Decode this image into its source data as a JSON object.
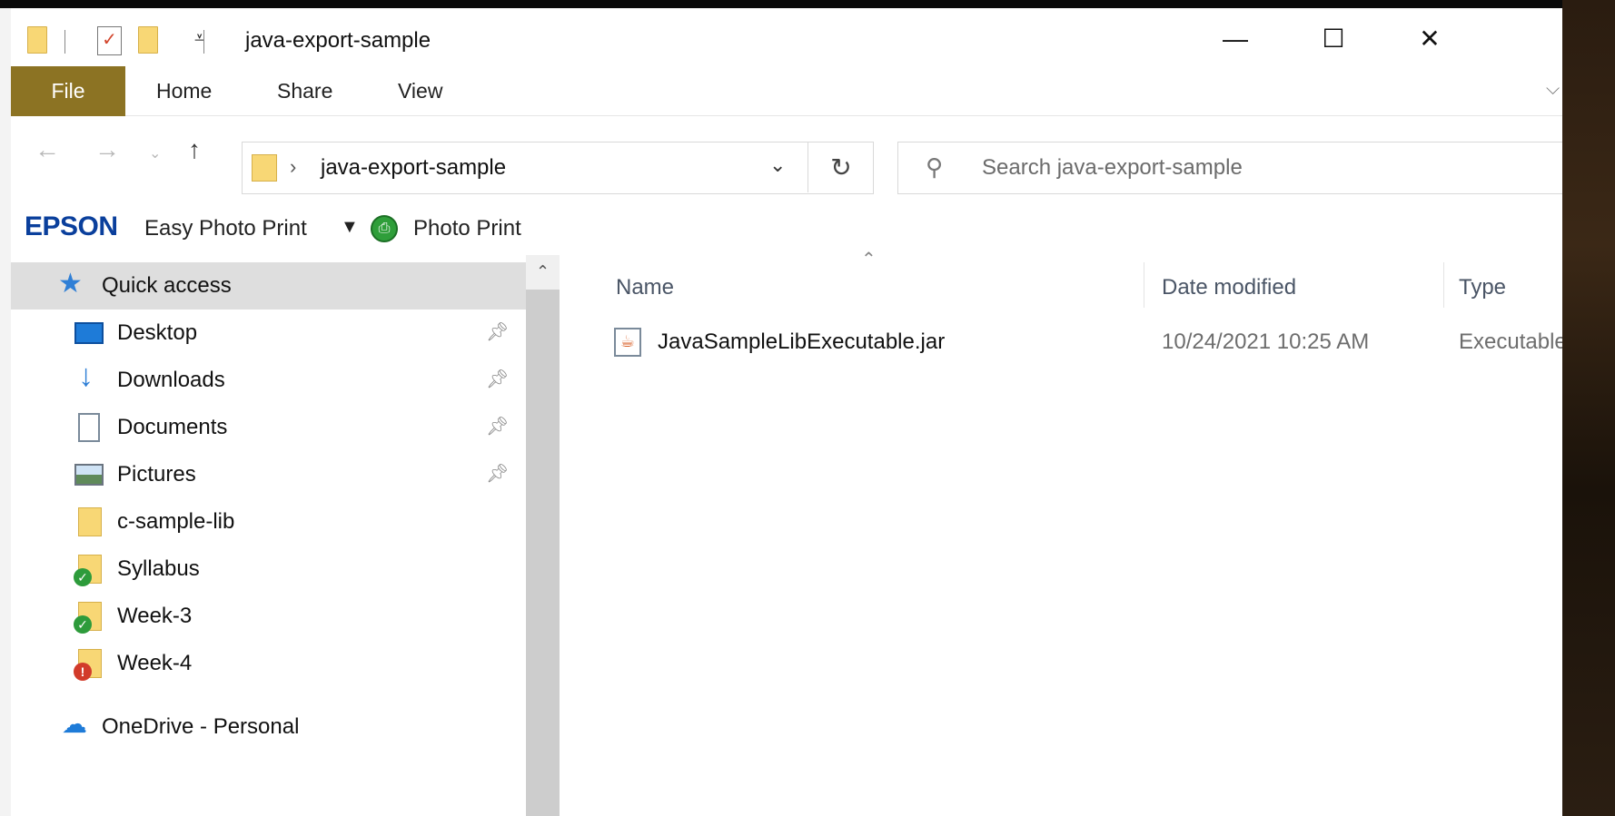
{
  "window": {
    "title": "java-export-sample",
    "minimize_glyph": "—",
    "maximize_glyph": "☐",
    "close_glyph": "✕"
  },
  "ribbon": {
    "tabs": [
      "File",
      "Home",
      "Share",
      "View"
    ],
    "help": "?"
  },
  "address": {
    "path": "java-export-sample",
    "search_placeholder": "Search java-export-sample"
  },
  "epson_bar": {
    "brand": "EPSON",
    "easy_photo_print": "Easy Photo Print",
    "photo_print": "Photo Print"
  },
  "nav": {
    "quick_access": "Quick access",
    "items": [
      {
        "label": "Desktop",
        "icon": "desktop-icon",
        "pinned": true
      },
      {
        "label": "Downloads",
        "icon": "download-icon",
        "pinned": true
      },
      {
        "label": "Documents",
        "icon": "documents-icon",
        "pinned": true
      },
      {
        "label": "Pictures",
        "icon": "pictures-icon",
        "pinned": true
      },
      {
        "label": "c-sample-lib",
        "icon": "folder-icon",
        "pinned": false
      },
      {
        "label": "Syllabus",
        "icon": "folder-synced-icon",
        "pinned": false
      },
      {
        "label": "Week-3",
        "icon": "folder-synced-icon",
        "pinned": false
      },
      {
        "label": "Week-4",
        "icon": "folder-error-icon",
        "pinned": false
      }
    ],
    "onedrive": "OneDrive - Personal"
  },
  "file_list": {
    "columns": {
      "name": "Name",
      "date": "Date modified",
      "type": "Type"
    },
    "rows": [
      {
        "name": "JavaSampleLibExecutable.jar",
        "date": "10/24/2021 10:25 AM",
        "type": "Executable Jar F"
      }
    ]
  },
  "colors": {
    "file_tab": "#8c7323",
    "accent_blue": "#1e7bd8",
    "epson_blue": "#0a3f9c",
    "folder_yellow": "#f8d775"
  }
}
